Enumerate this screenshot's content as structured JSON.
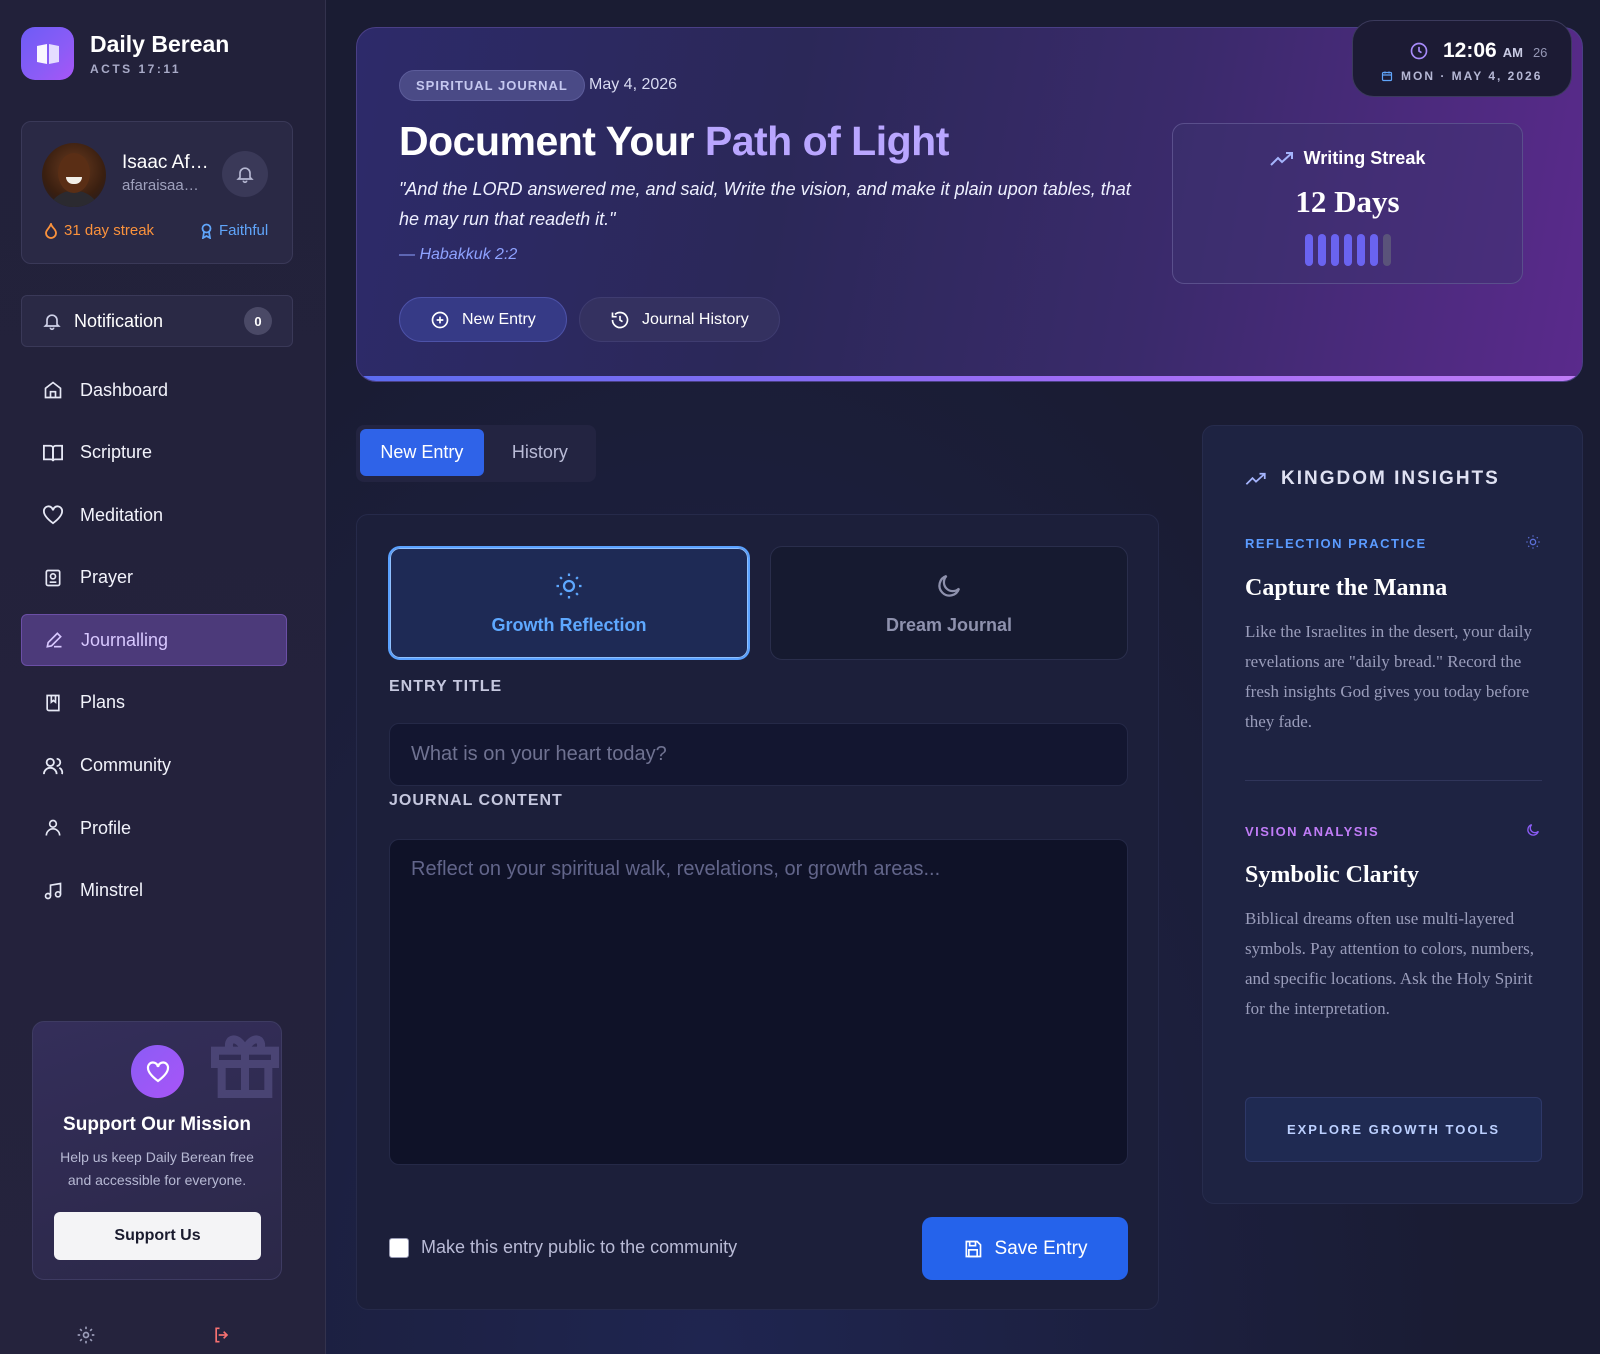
{
  "brand": {
    "name": "Daily Berean",
    "subtitle": "ACTS 17:11"
  },
  "user": {
    "name": "Isaac Afaraisaa",
    "email": "afaraisaa@gmail.com",
    "streak": "31 day streak",
    "level": "Faithful"
  },
  "notification": {
    "label": "Notification",
    "count": "0"
  },
  "nav": {
    "items": [
      {
        "label": "Dashboard",
        "icon": "home-icon"
      },
      {
        "label": "Scripture",
        "icon": "book-open-icon"
      },
      {
        "label": "Meditation",
        "icon": "heart-icon"
      },
      {
        "label": "Prayer",
        "icon": "prayer-icon"
      },
      {
        "label": "Journalling",
        "icon": "pen-icon",
        "active": true
      },
      {
        "label": "Plans",
        "icon": "bookmark-book-icon"
      },
      {
        "label": "Community",
        "icon": "users-icon"
      },
      {
        "label": "Profile",
        "icon": "user-icon"
      },
      {
        "label": "Minstrel",
        "icon": "music-icon"
      }
    ]
  },
  "support": {
    "title": "Support Our Mission",
    "text": "Help us keep Daily Berean free and accessible for everyone.",
    "button": "Support Us"
  },
  "hero": {
    "badge": "SPIRITUAL JOURNAL",
    "date": "May 4, 2026",
    "title_main": "Document Your ",
    "title_accent": "Path of Light",
    "quote": "\"And the LORD answered me, and said, Write the vision, and make it plain upon tables, that he may run that readeth it.\"",
    "reference": "— Habakkuk 2:2",
    "new_entry_label": "New Entry",
    "history_label": "Journal History"
  },
  "clock": {
    "time": "12:06",
    "ampm": "AM",
    "seconds": "26",
    "date": "MON · MAY 4, 2026"
  },
  "streak": {
    "label": "Writing Streak",
    "days": "12 Days",
    "filled": 6,
    "total": 7
  },
  "tabs": {
    "new_entry": "New Entry",
    "history": "History"
  },
  "form": {
    "growth_label": "Growth Reflection",
    "dream_label": "Dream Journal",
    "title_label": "ENTRY TITLE",
    "title_placeholder": "What is on your heart today?",
    "content_label": "JOURNAL CONTENT",
    "content_placeholder": "Reflect on your spiritual walk, revelations, or growth areas...",
    "public_label": "Make this entry public to the community",
    "save_label": "Save Entry"
  },
  "insights": {
    "heading": "KINGDOM INSIGHTS",
    "items": [
      {
        "category": "REFLECTION PRACTICE",
        "title": "Capture the Manna",
        "text": "Like the Israelites in the desert, your daily revelations are \"daily bread.\" Record the fresh insights God gives you today before they fade."
      },
      {
        "category": "VISION ANALYSIS",
        "title": "Symbolic Clarity",
        "text": "Biblical dreams often use multi-layered symbols. Pay attention to colors, numbers, and specific locations. Ask the Holy Spirit for the interpretation."
      }
    ],
    "explore": "EXPLORE GROWTH TOOLS"
  },
  "colors": {
    "accent_blue": "#2563eb",
    "accent_purple": "#8b5cf6",
    "streak_orange": "#fb923c",
    "logout_red": "#f87171"
  }
}
